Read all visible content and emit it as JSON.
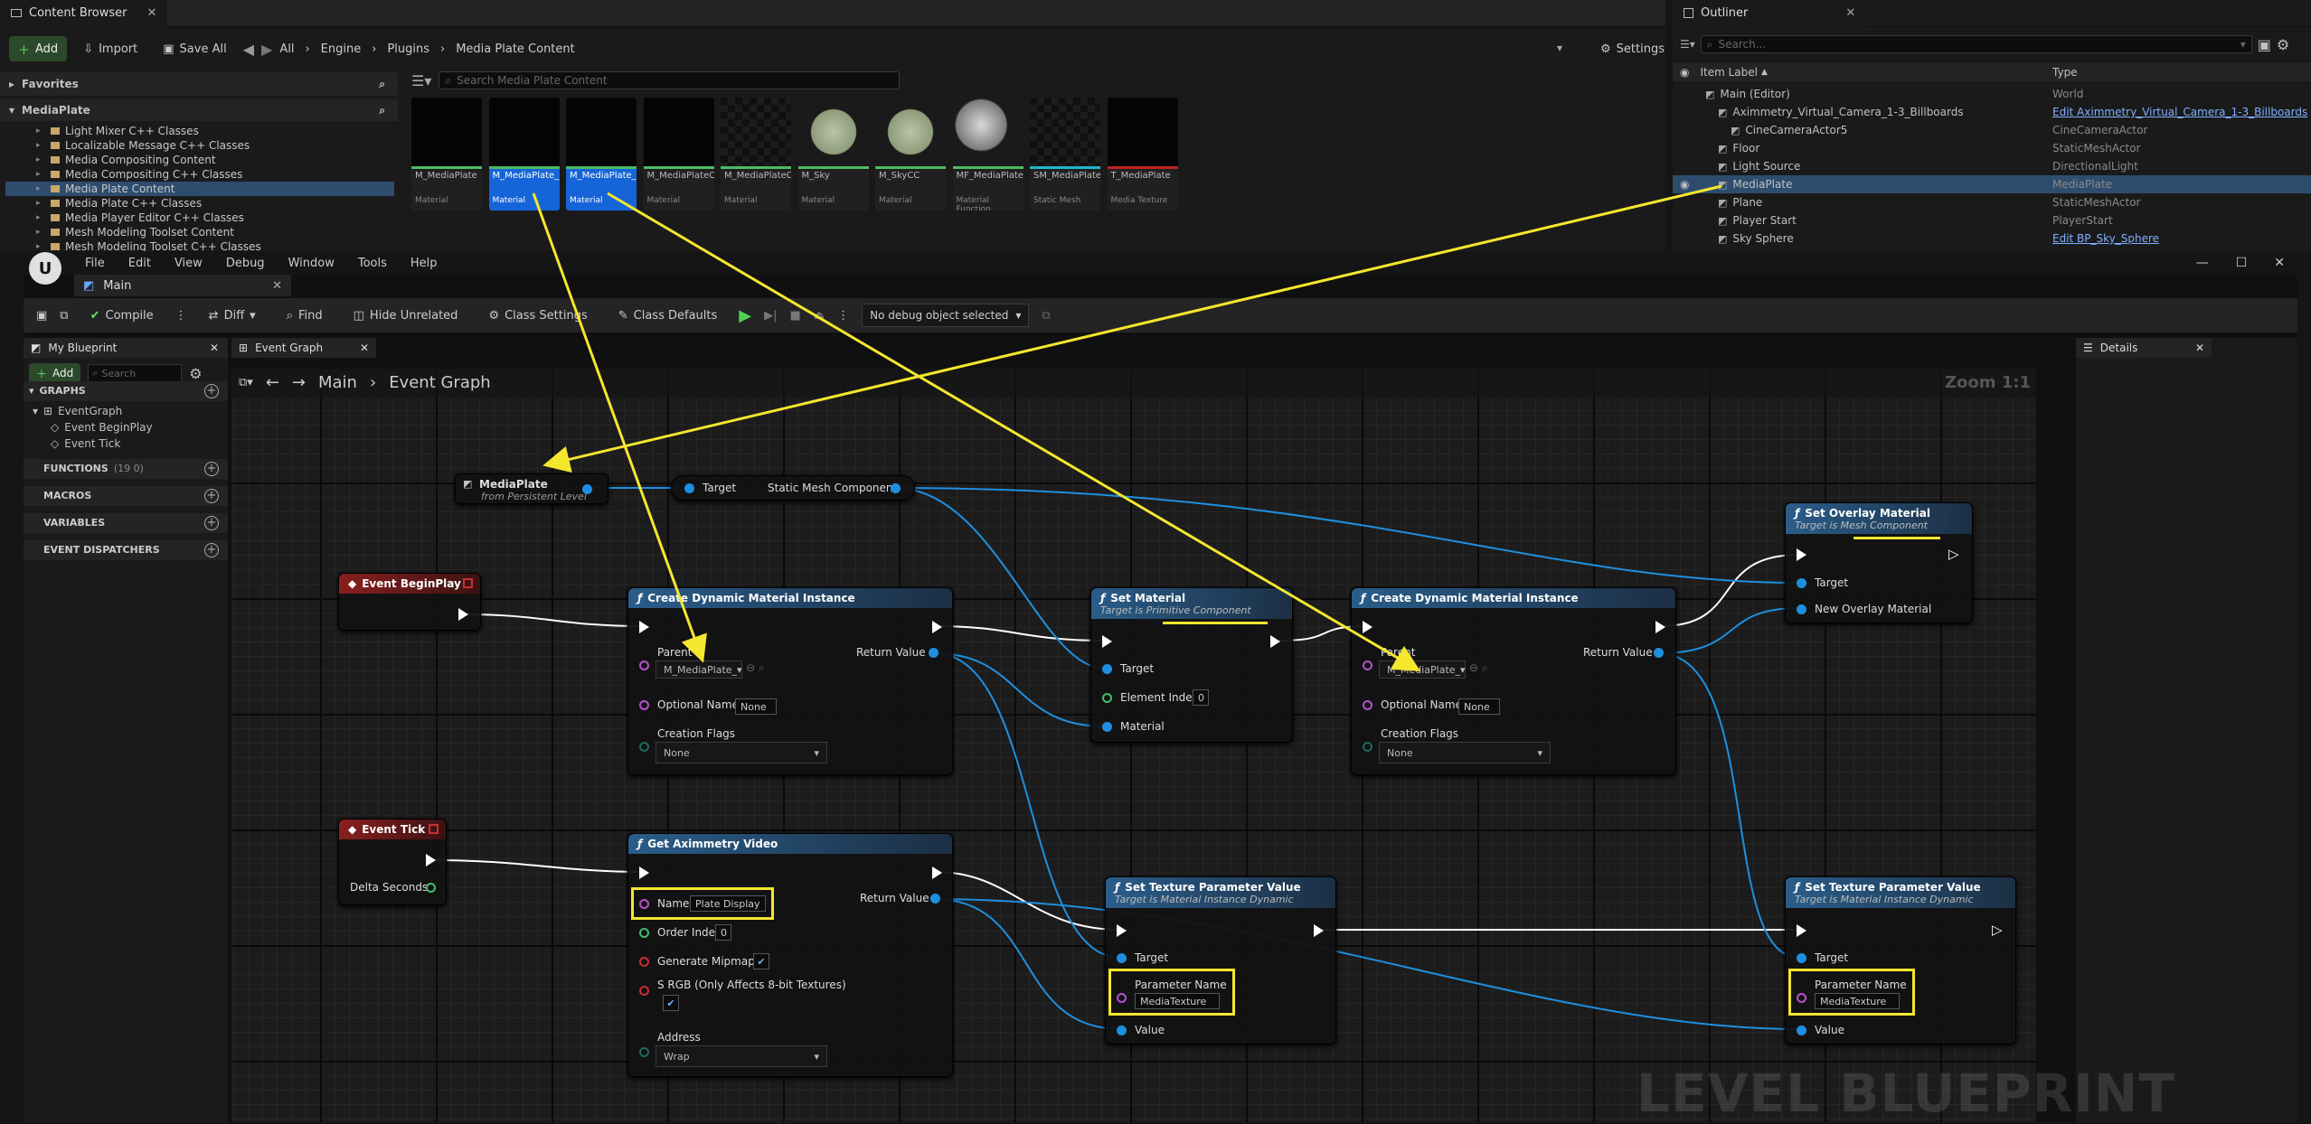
{
  "content_browser": {
    "tab_title": "Content Browser",
    "add_label": "Add",
    "import_label": "Import",
    "save_all_label": "Save All",
    "breadcrumb": [
      "All",
      "Engine",
      "Plugins",
      "Media Plate Content"
    ],
    "settings_label": "Settings",
    "favorites_label": "Favorites",
    "root_label": "MediaPlate",
    "search_placeholder": "Search Media Plate Content",
    "folders": [
      "Light Mixer C++ Classes",
      "Localizable Message C++ Classes",
      "Media Compositing Content",
      "Media Compositing C++ Classes",
      "Media Plate Content",
      "Media Plate C++ Classes",
      "Media Player Editor C++ Classes",
      "Mesh Modeling Toolset Content",
      "Mesh Modeling Toolset C++ Classes"
    ],
    "assets": [
      {
        "name": "M_MediaPlate",
        "type": "Material",
        "bar": "#4cba63",
        "thumb": "#050505",
        "selected": false
      },
      {
        "name": "M_MediaPlate_Masked",
        "type": "Material",
        "bar": "#4cba63",
        "thumb": "#050505",
        "selected": true
      },
      {
        "name": "M_MediaPlate_OverlayComp",
        "type": "Material",
        "bar": "#4cba63",
        "thumb": "#050505",
        "selected": true
      },
      {
        "name": "M_MediaPlateCC",
        "type": "Material",
        "bar": "#4cba63",
        "thumb": "#050505",
        "selected": false
      },
      {
        "name": "M_MediaPlateCrossFade",
        "type": "Material",
        "bar": "#4cba63",
        "thumb": "checker",
        "selected": false
      },
      {
        "name": "M_Sky",
        "type": "Material",
        "bar": "#4cba63",
        "thumb": "sphere-green",
        "selected": false
      },
      {
        "name": "M_SkyCC",
        "type": "Material",
        "bar": "#4cba63",
        "thumb": "sphere-green",
        "selected": false
      },
      {
        "name": "MF_MediaPlateDepth",
        "type": "Material Function",
        "bar": "#4cba63",
        "thumb": "sphere-grey",
        "selected": false
      },
      {
        "name": "SM_MediaPlateScreen",
        "type": "Static Mesh",
        "bar": "#1fb6c9",
        "thumb": "checker",
        "selected": false
      },
      {
        "name": "T_MediaPlate",
        "type": "Media Texture",
        "bar": "#c02020",
        "thumb": "#050505",
        "selected": false
      }
    ]
  },
  "outliner": {
    "tab_title": "Outliner",
    "search_placeholder": "Search...",
    "col_label": "Item Label",
    "col_type": "Type",
    "rows": [
      {
        "label": "Main (Editor)",
        "type": "World",
        "indent": 1,
        "link": false,
        "selected": false
      },
      {
        "label": "Aximmetry_Virtual_Camera_1-3_Billboards",
        "type": "Edit Aximmetry_Virtual_Camera_1-3_Billboards",
        "indent": 2,
        "link": true,
        "selected": false
      },
      {
        "label": "CineCameraActor5",
        "type": "CineCameraActor",
        "indent": 3,
        "link": false,
        "selected": false
      },
      {
        "label": "Floor",
        "type": "StaticMeshActor",
        "indent": 2,
        "link": false,
        "selected": false
      },
      {
        "label": "Light Source",
        "type": "DirectionalLight",
        "indent": 2,
        "link": false,
        "selected": false
      },
      {
        "label": "MediaPlate",
        "type": "MediaPlate",
        "indent": 2,
        "link": false,
        "selected": true
      },
      {
        "label": "Plane",
        "type": "StaticMeshActor",
        "indent": 2,
        "link": false,
        "selected": false
      },
      {
        "label": "Player Start",
        "type": "PlayerStart",
        "indent": 2,
        "link": false,
        "selected": false
      },
      {
        "label": "Sky Sphere",
        "type": "Edit BP_Sky_Sphere",
        "indent": 2,
        "link": true,
        "selected": false
      }
    ]
  },
  "editor": {
    "menu": [
      "File",
      "Edit",
      "Window",
      "Debug",
      "Window",
      "Tools",
      "Help"
    ],
    "menu_items": [
      "File",
      "Edit",
      "View",
      "Debug",
      "Window",
      "Tools",
      "Help"
    ],
    "doc_tab": "Main",
    "toolbar": {
      "compile": "Compile",
      "diff": "Diff",
      "find": "Find",
      "hide_unrelated": "Hide Unrelated",
      "class_settings": "Class Settings",
      "class_defaults": "Class Defaults",
      "debug_object": "No debug object selected"
    },
    "my_blueprint": {
      "tab": "My Blueprint",
      "add": "Add",
      "search_placeholder": "Search",
      "graphs": "GRAPHS",
      "event_graph": "EventGraph",
      "event_begin_play": "Event BeginPlay",
      "event_tick": "Event Tick",
      "functions": "FUNCTIONS",
      "functions_count": "(19 0)",
      "macros": "MACROS",
      "variables": "VARIABLES",
      "dispatchers": "EVENT DISPATCHERS"
    },
    "graph_tab": "Event Graph",
    "graph_path": [
      "Main",
      "Event Graph"
    ],
    "zoom": "Zoom 1:1",
    "details_tab": "Details",
    "watermark": "LEVEL BLUEPRINT"
  },
  "nodes": {
    "mediaplate_ref": {
      "title": "MediaPlate",
      "sub": "from Persistent Level"
    },
    "get_component": {
      "target": "Target",
      "out": "Static Mesh Component"
    },
    "begin_play": {
      "title": "Event BeginPlay"
    },
    "event_tick": {
      "title": "Event Tick",
      "delta": "Delta Seconds"
    },
    "cdmi1": {
      "title": "Create Dynamic Material Instance",
      "parent": "Parent",
      "parent_value": "M_MediaPlate_",
      "optional_name": "Optional Name",
      "optional_value": "None",
      "flags": "Creation Flags",
      "flags_value": "None",
      "return": "Return Value"
    },
    "set_material": {
      "title": "Set Material",
      "sub": "Target is Primitive Component",
      "target": "Target",
      "element_index": "Element Index",
      "element_value": "0",
      "material": "Material"
    },
    "cdmi2": {
      "title": "Create Dynamic Material Instance",
      "parent": "Parent",
      "parent_value": "M_MediaPlate_",
      "optional_name": "Optional Name",
      "optional_value": "None",
      "flags": "Creation Flags",
      "flags_value": "None",
      "return": "Return Value"
    },
    "set_overlay": {
      "title": "Set Overlay Material",
      "sub": "Target is Mesh Component",
      "target": "Target",
      "new": "New Overlay Material"
    },
    "get_video": {
      "title": "Get Aximmetry Video",
      "name": "Name",
      "name_value": "Plate Display",
      "order": "Order Index",
      "order_value": "0",
      "mipmaps": "Generate Mipmaps",
      "srgb": "S RGB (Only Affects 8-bit Textures)",
      "address": "Address",
      "address_value": "Wrap",
      "return": "Return Value"
    },
    "set_tex1": {
      "title": "Set Texture Parameter Value",
      "sub": "Target is Material Instance Dynamic",
      "target": "Target",
      "param": "Parameter Name",
      "param_value": "MediaTexture",
      "value": "Value"
    },
    "set_tex2": {
      "title": "Set Texture Parameter Value",
      "sub": "Target is Material Instance Dynamic",
      "target": "Target",
      "param": "Parameter Name",
      "param_value": "MediaTexture",
      "value": "Value"
    }
  },
  "colors": {
    "accent_yellow": "#f5e62e",
    "func_header": "#2a5d8a",
    "event_header": "#8a1f1f",
    "selection": "#1565d8",
    "pin_object": "#1e8fe0",
    "pin_name": "#b84fd0"
  }
}
